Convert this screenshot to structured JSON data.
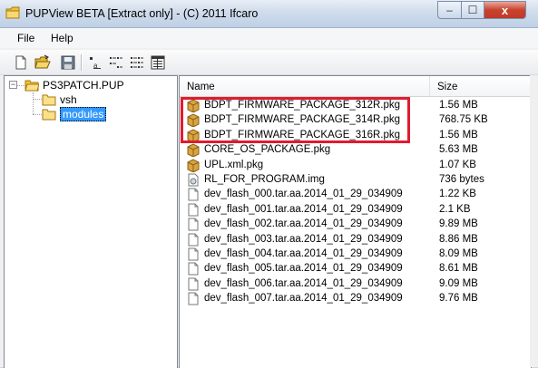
{
  "window": {
    "title": "PUPView BETA [Extract only] - (C) 2011 Ifcaro",
    "close_glyph": "x",
    "minimize_glyph": "–",
    "maximize_glyph": "☐"
  },
  "menu": [
    {
      "label": "File"
    },
    {
      "label": "Help"
    }
  ],
  "toolbar": {
    "buttons": [
      "new-icon",
      "open-icon",
      "save-icon",
      "large-icons-view-icon",
      "small-icons-view-icon",
      "list-view-icon",
      "details-view-icon"
    ]
  },
  "tree": {
    "root": {
      "label": "PS3PATCH.PUP",
      "expander": "−"
    },
    "children": [
      {
        "label": "vsh",
        "selected": false
      },
      {
        "label": "modules",
        "selected": true
      }
    ]
  },
  "list": {
    "columns": {
      "name": "Name",
      "size": "Size"
    },
    "rows": [
      {
        "name": "BDPT_FIRMWARE_PACKAGE_312R.pkg",
        "size": "1.56 MB",
        "icon": "package-icon"
      },
      {
        "name": "BDPT_FIRMWARE_PACKAGE_314R.pkg",
        "size": "768.75 KB",
        "icon": "package-icon"
      },
      {
        "name": "BDPT_FIRMWARE_PACKAGE_316R.pkg",
        "size": "1.56 MB",
        "icon": "package-icon"
      },
      {
        "name": "CORE_OS_PACKAGE.pkg",
        "size": "5.63 MB",
        "icon": "package-icon"
      },
      {
        "name": "UPL.xml.pkg",
        "size": "1.07 KB",
        "icon": "package-icon"
      },
      {
        "name": "RL_FOR_PROGRAM.img",
        "size": "736 bytes",
        "icon": "image-file-icon"
      },
      {
        "name": "dev_flash_000.tar.aa.2014_01_29_034909",
        "size": "1.22 KB",
        "icon": "file-icon"
      },
      {
        "name": "dev_flash_001.tar.aa.2014_01_29_034909",
        "size": "2.1 KB",
        "icon": "file-icon"
      },
      {
        "name": "dev_flash_002.tar.aa.2014_01_29_034909",
        "size": "9.89 MB",
        "icon": "file-icon"
      },
      {
        "name": "dev_flash_003.tar.aa.2014_01_29_034909",
        "size": "8.86 MB",
        "icon": "file-icon"
      },
      {
        "name": "dev_flash_004.tar.aa.2014_01_29_034909",
        "size": "8.09 MB",
        "icon": "file-icon"
      },
      {
        "name": "dev_flash_005.tar.aa.2014_01_29_034909",
        "size": "8.61 MB",
        "icon": "file-icon"
      },
      {
        "name": "dev_flash_006.tar.aa.2014_01_29_034909",
        "size": "9.09 MB",
        "icon": "file-icon"
      },
      {
        "name": "dev_flash_007.tar.aa.2014_01_29_034909",
        "size": "9.76 MB",
        "icon": "file-icon"
      }
    ]
  },
  "colors": {
    "highlight_box": "#e01b2f",
    "selection": "#3399ff",
    "folder": "#f5c542"
  }
}
